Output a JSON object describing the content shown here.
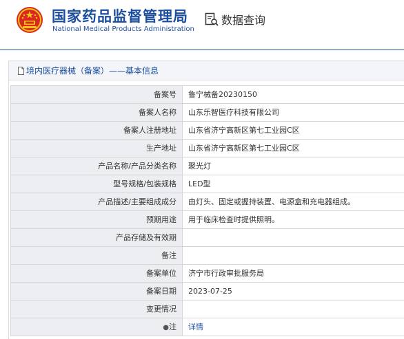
{
  "header": {
    "org_name_cn": "国家药品监督管理局",
    "org_name_en": "National Medical Products Administration",
    "query_label": "数据查询",
    "brand_color": "#1c4e9f"
  },
  "section": {
    "title": "境内医疗器械（备案）——基本信息"
  },
  "rows": [
    {
      "label": "备案号",
      "value": "鲁宁械备20230150"
    },
    {
      "label": "备案人名称",
      "value": "山东乐智医疗科技有限公司"
    },
    {
      "label": "备案人注册地址",
      "value": "山东省济宁高新区第七工业园C区"
    },
    {
      "label": "生产地址",
      "value": "山东省济宁高新区第七工业园C区"
    },
    {
      "label": "产品名称/产品分类名称",
      "value": "聚光灯"
    },
    {
      "label": "型号规格/包装规格",
      "value": "LED型"
    },
    {
      "label": "产品描述/主要组成成分",
      "value": "由灯头、固定或握持装置、电源盒和充电器组成。"
    },
    {
      "label": "预期用途",
      "value": "用于临床检查时提供照明。"
    },
    {
      "label": "产品存储及有效期",
      "value": ""
    },
    {
      "label": "备注",
      "value": ""
    },
    {
      "label": "备案单位",
      "value": "济宁市行政审批服务局"
    },
    {
      "label": "备案日期",
      "value": "2023-07-25"
    },
    {
      "label": "变更情况",
      "value": ""
    }
  ],
  "note_row": {
    "pin_glyph": "●",
    "label": "注",
    "link_text": "详情"
  }
}
